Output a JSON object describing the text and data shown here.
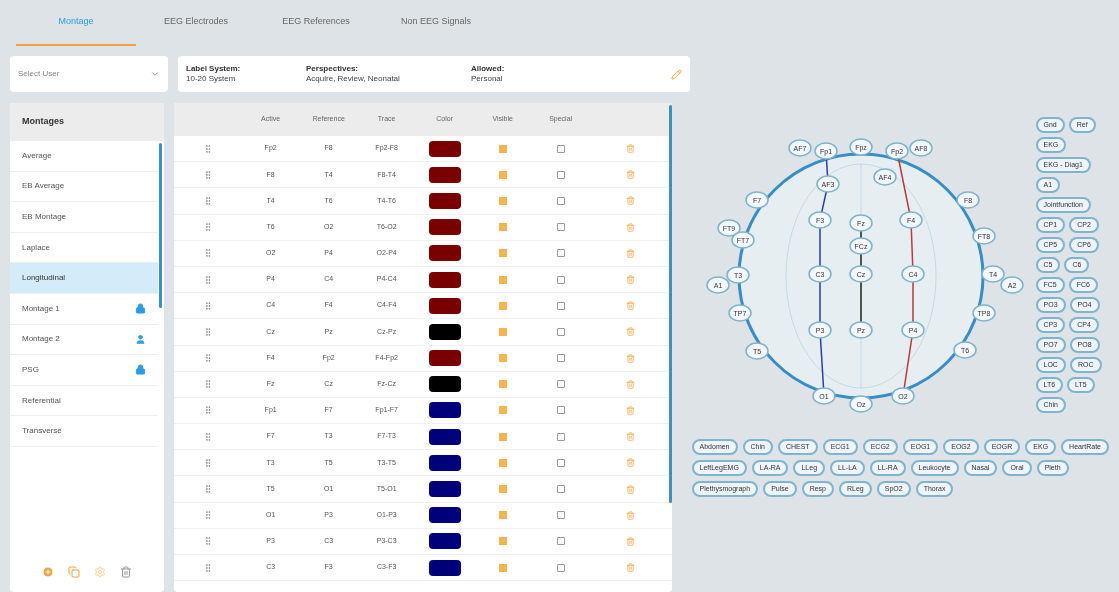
{
  "tabs": [
    {
      "label": "Montage",
      "selected": true
    },
    {
      "label": "EEG Electrodes",
      "selected": false
    },
    {
      "label": "EEG References",
      "selected": false
    },
    {
      "label": "Non EEG Signals",
      "selected": false
    }
  ],
  "user_select": {
    "placeholder": "Select User"
  },
  "info": [
    {
      "label": "Label System:",
      "value": "10-20 System"
    },
    {
      "label": "Perspectives:",
      "value": "Acquire, Review, Neonatal"
    },
    {
      "label": "Allowed:",
      "value": "Personal"
    }
  ],
  "montages": {
    "title": "Montages",
    "items": [
      {
        "label": "Average",
        "selected": false
      },
      {
        "label": "EB Average",
        "selected": false
      },
      {
        "label": "EB Montage",
        "selected": false
      },
      {
        "label": "Laplace",
        "selected": false
      },
      {
        "label": "Longitudinal",
        "selected": true
      },
      {
        "label": "Montage 1",
        "selected": false,
        "kind": "locked"
      },
      {
        "label": "Montage 2",
        "selected": false,
        "kind": "personal"
      },
      {
        "label": "PSG",
        "selected": false,
        "kind": "locked"
      },
      {
        "label": "Referential",
        "selected": false
      },
      {
        "label": "Transverse",
        "selected": false
      }
    ]
  },
  "table": {
    "columns": [
      "Active",
      "Reference",
      "Trace",
      "Color",
      "Visible",
      "Special"
    ],
    "rows": [
      {
        "active": "Fp2",
        "reference": "F8",
        "trace": "Fp2-F8",
        "color": "#7a0000",
        "visible": true,
        "special": false
      },
      {
        "active": "F8",
        "reference": "T4",
        "trace": "F8-T4",
        "color": "#7a0000",
        "visible": true,
        "special": false
      },
      {
        "active": "T4",
        "reference": "T6",
        "trace": "T4-T6",
        "color": "#7a0000",
        "visible": true,
        "special": false
      },
      {
        "active": "T6",
        "reference": "O2",
        "trace": "T6-O2",
        "color": "#7a0000",
        "visible": true,
        "special": false
      },
      {
        "active": "O2",
        "reference": "P4",
        "trace": "O2-P4",
        "color": "#7a0000",
        "visible": true,
        "special": false
      },
      {
        "active": "P4",
        "reference": "C4",
        "trace": "P4-C4",
        "color": "#7a0000",
        "visible": true,
        "special": false
      },
      {
        "active": "C4",
        "reference": "F4",
        "trace": "C4-F4",
        "color": "#7a0000",
        "visible": true,
        "special": false
      },
      {
        "active": "Cz",
        "reference": "Pz",
        "trace": "Cz-Pz",
        "color": "#000000",
        "visible": true,
        "special": false
      },
      {
        "active": "F4",
        "reference": "Fp2",
        "trace": "F4-Fp2",
        "color": "#7a0000",
        "visible": true,
        "special": false
      },
      {
        "active": "Fz",
        "reference": "Cz",
        "trace": "Fz-Cz",
        "color": "#000000",
        "visible": true,
        "special": false
      },
      {
        "active": "Fp1",
        "reference": "F7",
        "trace": "Fp1-F7",
        "color": "#00007a",
        "visible": true,
        "special": false
      },
      {
        "active": "F7",
        "reference": "T3",
        "trace": "F7-T3",
        "color": "#00007a",
        "visible": true,
        "special": false
      },
      {
        "active": "T3",
        "reference": "T5",
        "trace": "T3-T5",
        "color": "#00007a",
        "visible": true,
        "special": false
      },
      {
        "active": "T5",
        "reference": "O1",
        "trace": "T5-O1",
        "color": "#00007a",
        "visible": true,
        "special": false
      },
      {
        "active": "O1",
        "reference": "P3",
        "trace": "O1-P3",
        "color": "#00007a",
        "visible": true,
        "special": false
      },
      {
        "active": "P3",
        "reference": "C3",
        "trace": "P3-C3",
        "color": "#00007a",
        "visible": true,
        "special": false
      },
      {
        "active": "C3",
        "reference": "F3",
        "trace": "C3-F3",
        "color": "#00007a",
        "visible": true,
        "special": false
      }
    ]
  },
  "head_electrodes": [
    "AF7",
    "Fp1",
    "Fpz",
    "Fp2",
    "AF8",
    "AF3",
    "AF4",
    "F7",
    "F8",
    "F3",
    "Fz",
    "F4",
    "FT9",
    "FT7",
    "FT8",
    "FCz",
    "A1",
    "T3",
    "C3",
    "Cz",
    "C4",
    "T4",
    "A2",
    "TP7",
    "TP8",
    "P3",
    "Pz",
    "P4",
    "T5",
    "T6",
    "O1",
    "Oz",
    "O2"
  ],
  "side_electrodes": [
    [
      "Gnd",
      "Ref"
    ],
    [
      "EKG"
    ],
    [
      "EKG - Diag1"
    ],
    [
      "A1"
    ],
    [
      "Jointfunction"
    ],
    [
      "CP1",
      "CP2"
    ],
    [
      "CP5",
      "CP6"
    ],
    [
      "C5",
      "C6"
    ],
    [
      "FC5",
      "FC6"
    ],
    [
      "PO3",
      "PO4"
    ],
    [
      "CP3",
      "CP4"
    ],
    [
      "PO7",
      "PO8"
    ],
    [
      "LOC",
      "ROC"
    ],
    [
      "LT6",
      "LT5"
    ],
    [
      "Chin"
    ]
  ],
  "signals": [
    [
      "Abdomen",
      "Chin",
      "CHEST",
      "ECG1",
      "ECG2",
      "EOG1",
      "EOG2",
      "EOGR",
      "EKG",
      "HeartRate"
    ],
    [
      "LeftLegEMG",
      "LA-RA",
      "LLeg",
      "LL-LA",
      "LL-RA",
      "Leukocyte",
      "Nasal",
      "Oral",
      "Pleth"
    ],
    [
      "Plethysmograph",
      "Pulse",
      "Resp",
      "RLeg",
      "SpO2",
      "Thorax"
    ]
  ]
}
